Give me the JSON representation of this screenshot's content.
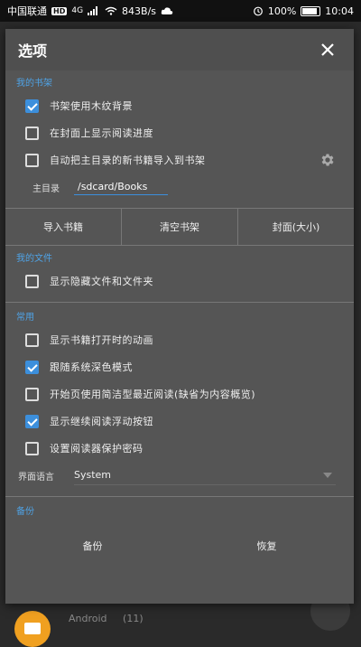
{
  "status_bar": {
    "carrier": "中国联通",
    "hd": "HD",
    "network": "4G",
    "speed": "843B/s",
    "battery": "100%",
    "time": "10:04"
  },
  "dialog": {
    "title": "选项",
    "close_icon": "close-icon",
    "sections": {
      "bookshelf": {
        "title": "我的书架",
        "options": [
          {
            "label": "书架使用木纹背景",
            "checked": true
          },
          {
            "label": "在封面上显示阅读进度",
            "checked": false
          },
          {
            "label": "自动把主目录的新书籍导入到书架",
            "checked": false
          }
        ],
        "dir_label": "主目录",
        "dir_value": "/sdcard/Books",
        "buttons": [
          "导入书籍",
          "清空书架",
          "封面(大小)"
        ]
      },
      "files": {
        "title": "我的文件",
        "options": [
          {
            "label": "显示隐藏文件和文件夹",
            "checked": false
          }
        ]
      },
      "general": {
        "title": "常用",
        "options": [
          {
            "label": "显示书籍打开时的动画",
            "checked": false
          },
          {
            "label": "跟随系统深色模式",
            "checked": true
          },
          {
            "label": "开始页使用简洁型最近阅读(缺省为内容概览)",
            "checked": false
          },
          {
            "label": "显示继续阅读浮动按钮",
            "checked": true
          },
          {
            "label": "设置阅读器保护密码",
            "checked": false
          }
        ],
        "language_label": "界面语言",
        "language_value": "System"
      },
      "backup": {
        "title": "备份",
        "buttons": [
          "备份",
          "恢复"
        ]
      }
    }
  },
  "background": {
    "app_text": "Android",
    "count": "(11)"
  },
  "colors": {
    "accent": "#3c8fdc",
    "section_title": "#4fa3e6",
    "dialog_bg": "#555555"
  }
}
